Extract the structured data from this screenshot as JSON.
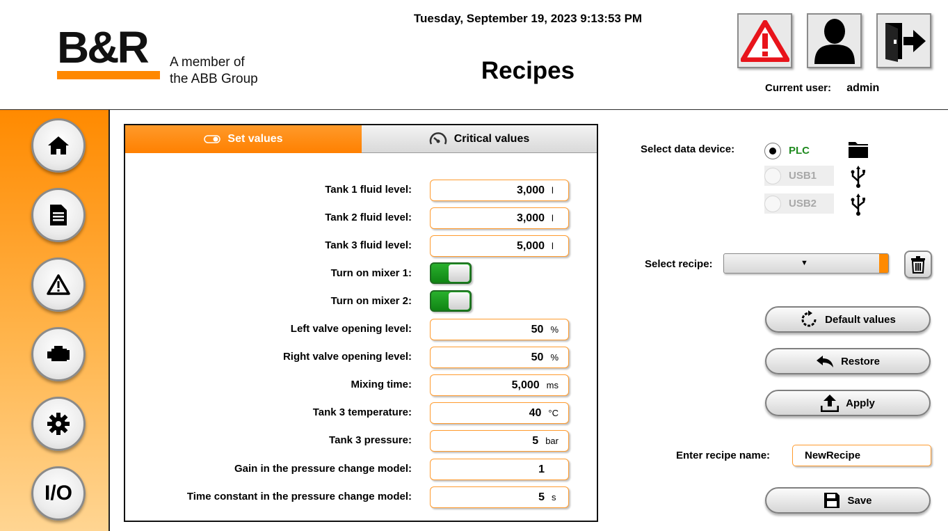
{
  "header": {
    "brand": "B&R",
    "member_line1": "A member of",
    "member_line2": "the ABB Group",
    "datetime": "Tuesday, September 19, 2023 9:13:53 PM",
    "title": "Recipes",
    "current_user_label": "Current user:",
    "current_user": "admin",
    "buttons": [
      "alarm-warning-icon",
      "user-icon",
      "logout-icon"
    ]
  },
  "sidebar": {
    "items": [
      {
        "icon": "home-icon"
      },
      {
        "icon": "document-icon"
      },
      {
        "icon": "warning-icon"
      },
      {
        "icon": "engine-icon"
      },
      {
        "icon": "gear-icon"
      },
      {
        "label": "I/O"
      }
    ]
  },
  "tabs": {
    "set_values": "Set values",
    "critical_values": "Critical values"
  },
  "fields": [
    {
      "label": "Tank 1 fluid level:",
      "value": "3,000",
      "unit": "l"
    },
    {
      "label": "Tank 2 fluid level:",
      "value": "3,000",
      "unit": "l"
    },
    {
      "label": "Tank 3 fluid level:",
      "value": "5,000",
      "unit": "l"
    },
    {
      "label": "Turn on mixer 1:",
      "toggle": true
    },
    {
      "label": "Turn on mixer 2:",
      "toggle": true
    },
    {
      "label": "Left valve opening level:",
      "value": "50",
      "unit": "%"
    },
    {
      "label": "Right valve opening level:",
      "value": "50",
      "unit": "%"
    },
    {
      "label": "Mixing time:",
      "value": "5,000",
      "unit": "ms"
    },
    {
      "label": "Tank 3 temperature:",
      "value": "40",
      "unit": "°C"
    },
    {
      "label": "Tank 3 pressure:",
      "value": "5",
      "unit": "bar"
    },
    {
      "label": "Gain in the pressure change model:",
      "value": "1",
      "unit": ""
    },
    {
      "label": "Time constant in the pressure change model:",
      "value": "5",
      "unit": "s"
    }
  ],
  "device": {
    "label": "Select data device:",
    "options": [
      {
        "name": "PLC",
        "selected": true,
        "enabled": true,
        "icon": "folder-icon"
      },
      {
        "name": "USB1",
        "selected": false,
        "enabled": false,
        "icon": "usb-icon"
      },
      {
        "name": "USB2",
        "selected": false,
        "enabled": false,
        "icon": "usb-icon"
      }
    ]
  },
  "recipe": {
    "label": "Select recipe:",
    "selected": ""
  },
  "actions": {
    "default_values": "Default values",
    "restore": "Restore",
    "apply": "Apply",
    "save": "Save"
  },
  "recipe_name": {
    "label": "Enter recipe name:",
    "value": "NewRecipe"
  },
  "colors": {
    "accent": "#ff8800",
    "toggle_on": "#1a9a1e",
    "plc_green": "#1f8a1f"
  }
}
